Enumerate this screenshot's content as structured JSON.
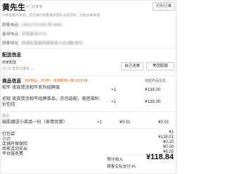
{
  "header": {
    "customer_name": "黄先生",
    "customer_sub": "#门店新客",
    "print_label": "打印订单"
  },
  "notice": "为保证服务体验，您在拨打或者接听隐私号电话时，可能会被录音",
  "info": [
    {
      "label": "顾客电话",
      "value": "18813751968 转 8683"
    },
    {
      "label": "备用电话",
      "value": "手机尾号0792"
    },
    {
      "label": "顾客地址",
      "value": "西湖区某某街道某某小区6幢2单元"
    }
  ],
  "delivery": {
    "title": "配送信息",
    "status": "商家配送",
    "time": "15:20 发单已接单",
    "btn_self": "自己送餐",
    "btn_other": "美团跑腿"
  },
  "products": {
    "title": "商品信息",
    "badge": "1份商品，共1件，本单即将入账 ¥118.84",
    "fold_label": "收起商品信息",
    "items": [
      {
        "name": "和牛 夜宵煲汤和牛系列招牌菜",
        "note": "亦可选辣度中辣",
        "qty": "×1",
        "price": "¥138.00"
      },
      {
        "name": "初现 夜宵煲汤和牛组牌菜品，亦可选配，美团福利价包括",
        "note": "",
        "qty": "×1",
        "price": "¥138.00"
      }
    ],
    "gift_title": "赠品",
    "gift": {
      "name": "鼓肌赠送小菜品一份（表情优惠）",
      "qty": "×1",
      "price": "¥0.01",
      "sub": "¥0.01"
    }
  },
  "summary": [
    {
      "label": "打包袋",
      "value": "¥1"
    },
    {
      "label": "小计",
      "value": "¥138.01"
    },
    {
      "label": "店铺环保保险",
      "value": "¥0.20"
    },
    {
      "label": "商家活动支出",
      "value": "¥0.00"
    },
    {
      "label": "平台服务费",
      "value": "¥6.25"
    }
  ],
  "total": {
    "label": "预计收入",
    "amount": "¥118.84",
    "paid_label": "顾客实际支付",
    "paid_value": "¥1"
  }
}
